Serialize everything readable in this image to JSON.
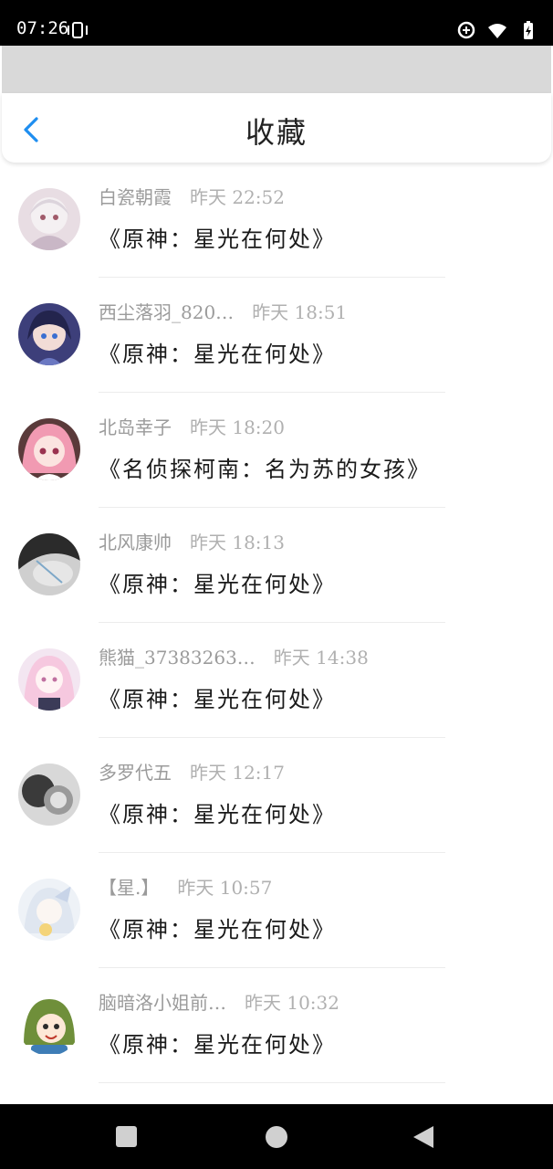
{
  "status_bar": {
    "time": "07:26",
    "icons": [
      "vibrate-icon",
      "data-saver-icon",
      "wifi-icon",
      "battery-charging-icon"
    ]
  },
  "header": {
    "title": "收藏",
    "back_icon": "chevron-left-icon",
    "accent_color": "#1e8ef0"
  },
  "favorites": [
    {
      "user": "白瓷朝霞",
      "time": "昨天 22:52",
      "title": "《原神：星光在何处》",
      "avatar": "anime-girl-white-hair"
    },
    {
      "user": "西尘落羽_820…",
      "time": "昨天 18:51",
      "title": "《原神：星光在何处》",
      "avatar": "anime-girl-dark-hair"
    },
    {
      "user": "北岛幸子",
      "time": "昨天 18:20",
      "title": "《名侦探柯南：名为苏的女孩》",
      "avatar": "anime-girl-pink-hair"
    },
    {
      "user": "北风康帅",
      "time": "昨天 18:13",
      "title": "《原神：星光在何处》",
      "avatar": "photo-dark"
    },
    {
      "user": "熊猫_37383263…",
      "time": "昨天 14:38",
      "title": "《原神：星光在何处》",
      "avatar": "anime-girl-pastel"
    },
    {
      "user": "多罗代五",
      "time": "昨天 12:17",
      "title": "《原神：星光在何处》",
      "avatar": "photo-bw"
    },
    {
      "user": "【星.】",
      "time": "昨天 10:57",
      "title": "《原神：星光在何处》",
      "avatar": "anime-girl-light"
    },
    {
      "user": "脑暗洛小姐前…",
      "time": "昨天 10:32",
      "title": "《原神：星光在何处》",
      "avatar": "chibi-green-hair"
    }
  ],
  "nav_bar": {
    "buttons": [
      "recent-apps-icon",
      "home-icon",
      "back-icon"
    ]
  }
}
